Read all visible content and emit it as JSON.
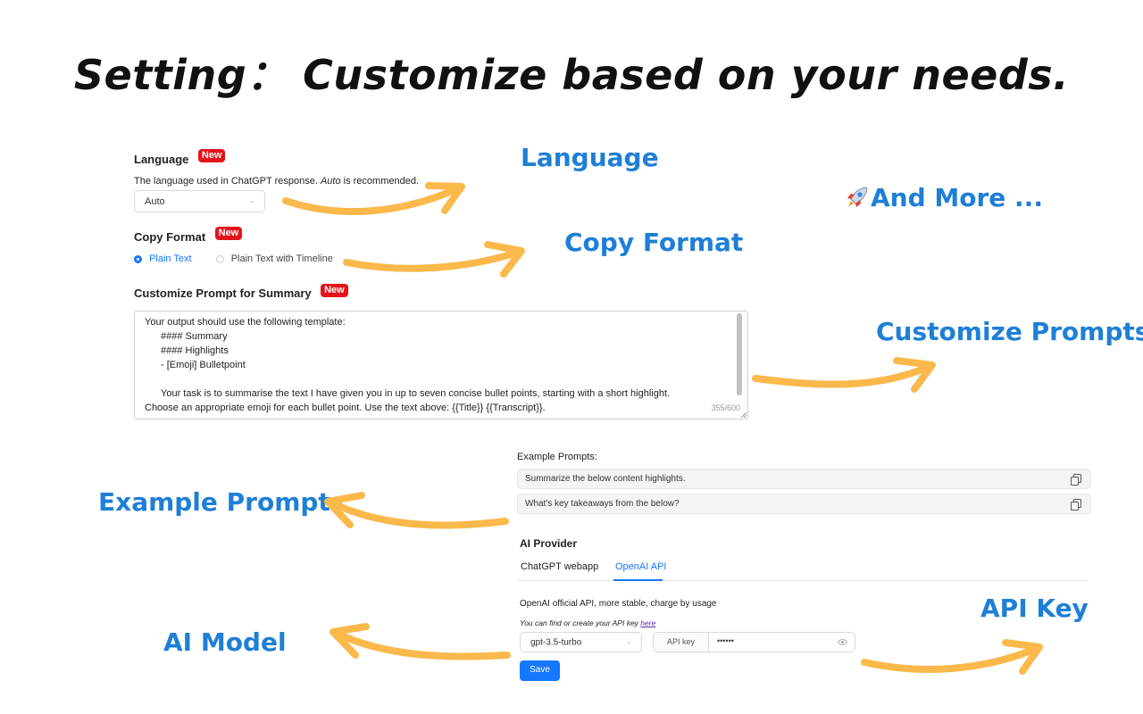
{
  "page": {
    "title": "Setting： Customize based on your needs."
  },
  "callouts": {
    "language": "Language",
    "copy_format": "Copy Format",
    "and_more": "And More ...",
    "customize_prompts": "Customize Prompts",
    "example_prompts": "Example Prompts",
    "ai_model": "AI Model",
    "api_key": "API Key"
  },
  "colors": {
    "callout": "#1e7fd6",
    "arrow": "#fbb84b",
    "badge": "#e4141b",
    "accent": "#1677ff"
  },
  "language_section": {
    "title": "Language",
    "badge": "New",
    "desc_before": "The language used in ChatGPT response. ",
    "desc_italic": "Auto",
    "desc_after": " is recommended.",
    "selected": "Auto"
  },
  "copy_format": {
    "title": "Copy Format",
    "badge": "New",
    "options": [
      {
        "label": "Plain Text",
        "selected": true
      },
      {
        "label": "Plain Text with Timeline",
        "selected": false
      }
    ]
  },
  "prompt_section": {
    "title": "Customize Prompt for Summary",
    "badge": "New",
    "lines": [
      "Your output should use the following template:",
      "#### Summary",
      "#### Highlights",
      "- [Emoji] Bulletpoint",
      "",
      "Your task is to summarise the text I have given you in up to seven concise bullet points, starting with a short highlight. Choose an appropriate emoji for each bullet point. Use the text above: {{Title}} {{Transcript}}."
    ],
    "counter": "355/600"
  },
  "example_prompts": {
    "label": "Example Prompts:",
    "items": [
      "Summarize the below content highlights.",
      "What's key takeaways from the below?"
    ]
  },
  "ai_provider": {
    "title": "AI Provider",
    "tabs": [
      {
        "label": "ChatGPT webapp",
        "active": false
      },
      {
        "label": "OpenAI API",
        "active": true
      }
    ],
    "desc": "OpenAI official API, more stable, charge by usage",
    "hint_before": "You can find or create your API key ",
    "hint_link": "here",
    "model": "gpt-3.5-turbo",
    "api_key_label": "API key",
    "api_key_value": "••••••",
    "save_label": "Save"
  }
}
